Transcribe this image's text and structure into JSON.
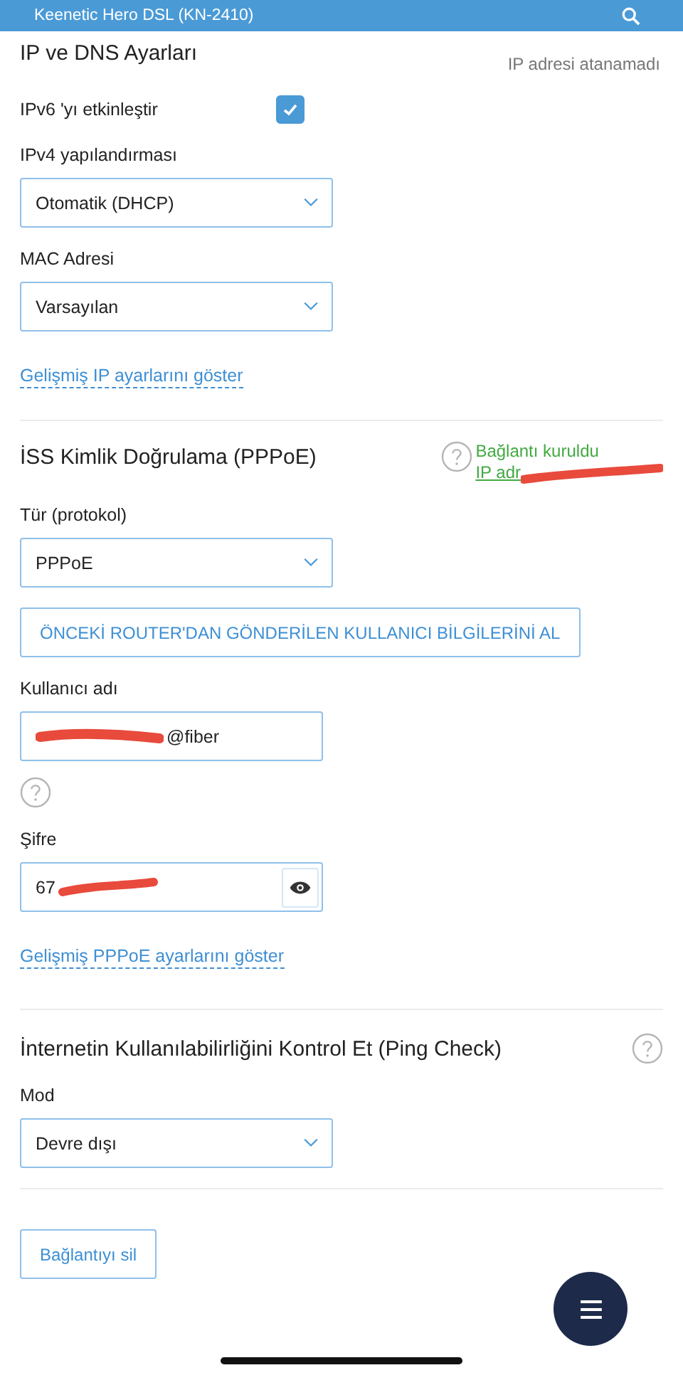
{
  "header": {
    "title": "Keenetic Hero DSL (KN-2410)"
  },
  "sections": [
    {
      "title": "IP ve DNS Ayarları",
      "status": [
        {
          "text": "IP adresi atanamadı",
          "color": "#777777",
          "redacted": false
        }
      ],
      "items": [
        {
          "kind": "checkbox",
          "label": "IPv6 'yı etkinleştir",
          "checked": true
        },
        {
          "kind": "select",
          "label": "IPv4 yapılandırması",
          "value": "Otomatik (DHCP)"
        },
        {
          "kind": "select",
          "label": "MAC Adresi",
          "value": "Varsayılan"
        },
        {
          "kind": "link",
          "text": "Gelişmiş IP ayarlarını göster"
        }
      ]
    },
    {
      "title": "İSS Kimlik Doğrulama (PPPoE)",
      "help": true,
      "status": [
        {
          "text": "Bağlantı kuruldu",
          "color": "#43a943",
          "redacted": false
        },
        {
          "text": "IP adr",
          "color": "#43a943",
          "redacted": true
        }
      ],
      "items": [
        {
          "kind": "select",
          "label": "Tür (protokol)",
          "value": "PPPoE"
        },
        {
          "kind": "button",
          "text": "ÖNCEKİ ROUTER'DAN GÖNDERİLEN KULLANICI BİLGİLERİNİ AL"
        },
        {
          "kind": "text",
          "label": "Kullanıcı adı",
          "value": "@fiber",
          "redacted": true
        },
        {
          "kind": "help"
        },
        {
          "kind": "password",
          "label": "Şifre",
          "value": "67",
          "redacted": true
        },
        {
          "kind": "link",
          "text": "Gelişmiş PPPoE ayarlarını göster"
        }
      ]
    },
    {
      "title": "İnternetin Kullanılabilirliğini Kontrol Et (Ping Check)",
      "help": true,
      "items": [
        {
          "kind": "select",
          "label": "Mod",
          "value": "Devre dışı"
        }
      ]
    },
    {
      "items": [
        {
          "kind": "button",
          "text": "Bağlantıyı sil"
        }
      ]
    }
  ]
}
